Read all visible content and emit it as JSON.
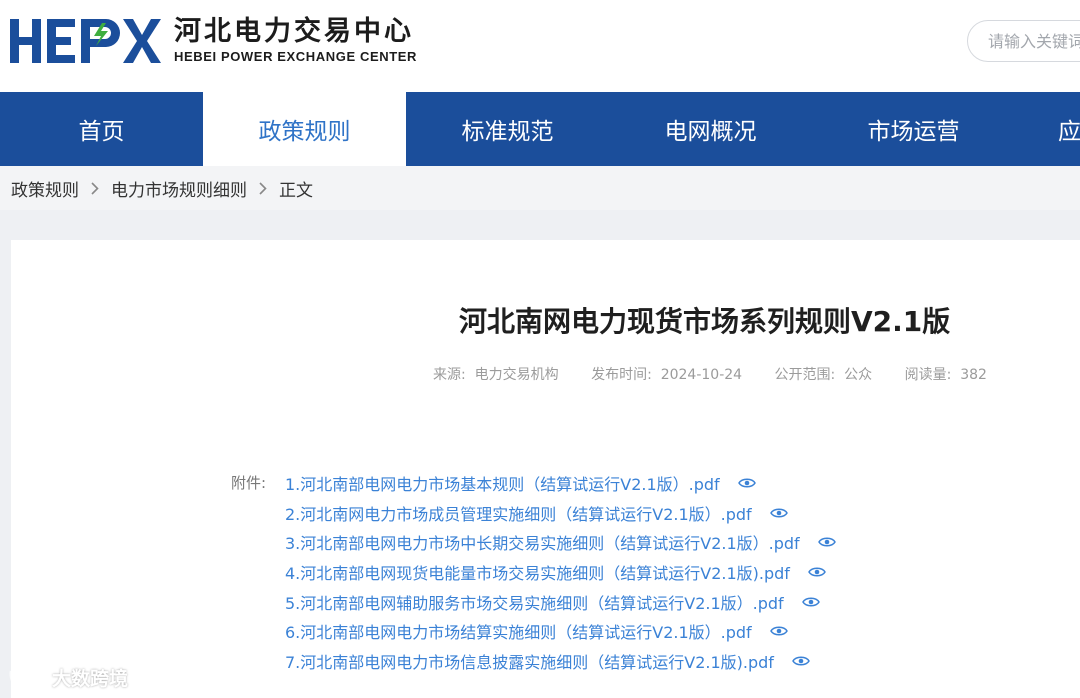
{
  "logo": {
    "mark_text": "HEPX",
    "name_cn": "河北电力交易中心",
    "name_en": "HEBEI POWER EXCHANGE CENTER",
    "colors": {
      "primary": "#1b4e9b",
      "accent": "#3fae3f"
    }
  },
  "search": {
    "placeholder": "请输入关键词"
  },
  "nav": {
    "items": [
      {
        "label": "首页"
      },
      {
        "label": "政策规则",
        "active": true
      },
      {
        "label": "标准规范"
      },
      {
        "label": "电网概况"
      },
      {
        "label": "市场运营"
      },
      {
        "label": "应"
      }
    ],
    "colors": {
      "background": "#1b4e9b",
      "active_text": "#2f73c7"
    }
  },
  "breadcrumb": {
    "items": [
      "政策规则",
      "电力市场规则细则",
      "正文"
    ],
    "separator_icon": "chevron-right-icon"
  },
  "article": {
    "title": "河北南网电力现货市场系列规则V2.1版",
    "meta": {
      "source_label": "来源:",
      "source_value": "电力交易机构",
      "date_label": "发布时间:",
      "date_value": "2024-10-24",
      "scope_label": "公开范围:",
      "scope_value": "公众",
      "reads_label": "阅读量:",
      "reads_value": "382"
    },
    "attachments_label": "附件:",
    "attachments": [
      "1.河北南部电网电力市场基本规则（结算试运行V2.1版）.pdf",
      "2.河北南网电力市场成员管理实施细则（结算试运行V2.1版）.pdf",
      "3.河北南部电网电力市场中长期交易实施细则（结算试运行V2.1版）.pdf",
      "4.河北南部电网现货电能量市场交易实施细则（结算试运行V2.1版).pdf",
      "5.河北南部电网辅助服务市场交易实施细则（结算试运行V2.1版）.pdf",
      "6.河北南部电网电力市场结算实施细则（结算试运行V2.1版）.pdf",
      "7.河北南部电网电力市场信息披露实施细则（结算试运行V2.1版).pdf"
    ],
    "preview_icon": "eye-icon",
    "link_color": "#3b82d6"
  },
  "watermark": {
    "text": "大数跨境"
  }
}
